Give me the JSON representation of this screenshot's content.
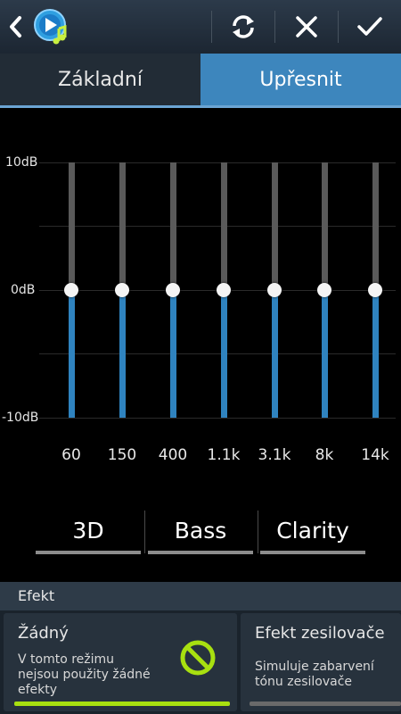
{
  "topbar": {
    "back_icon": "chevron-left-icon",
    "app_icon": "music-player-icon",
    "reset_icon": "refresh-icon",
    "cancel_icon": "close-icon",
    "confirm_icon": "check-icon"
  },
  "tabs": [
    {
      "label": "Základní",
      "selected": false
    },
    {
      "label": "Upřesnit",
      "selected": true
    }
  ],
  "equalizer": {
    "db_labels": {
      "top": "10dB",
      "mid": "0dB",
      "bottom": "-10dB"
    },
    "range_db": [
      -10,
      10
    ],
    "bands": [
      {
        "label": "60",
        "value_db": 0
      },
      {
        "label": "150",
        "value_db": 0
      },
      {
        "label": "400",
        "value_db": 0
      },
      {
        "label": "1.1k",
        "value_db": 0
      },
      {
        "label": "3.1k",
        "value_db": 0
      },
      {
        "label": "8k",
        "value_db": 0
      },
      {
        "label": "14k",
        "value_db": 0
      }
    ],
    "colors": {
      "fill": "#2f83bf",
      "track": "#5a5a5a"
    }
  },
  "effects_buttons": [
    {
      "label": "3D"
    },
    {
      "label": "Bass"
    },
    {
      "label": "Clarity"
    }
  ],
  "efekt": {
    "header": "Efekt",
    "cards": [
      {
        "title": "Žádný",
        "description_lines": [
          "V tomto režimu",
          "nejsou použity žádné",
          "efekty"
        ],
        "selected": true,
        "icon": "no-entry-icon"
      },
      {
        "title": "Efekt zesilovače",
        "description_lines": [
          "Simuluje zabarvení",
          "tónu zesilovače"
        ],
        "selected": false
      }
    ],
    "accent_color": "#a8e010"
  }
}
